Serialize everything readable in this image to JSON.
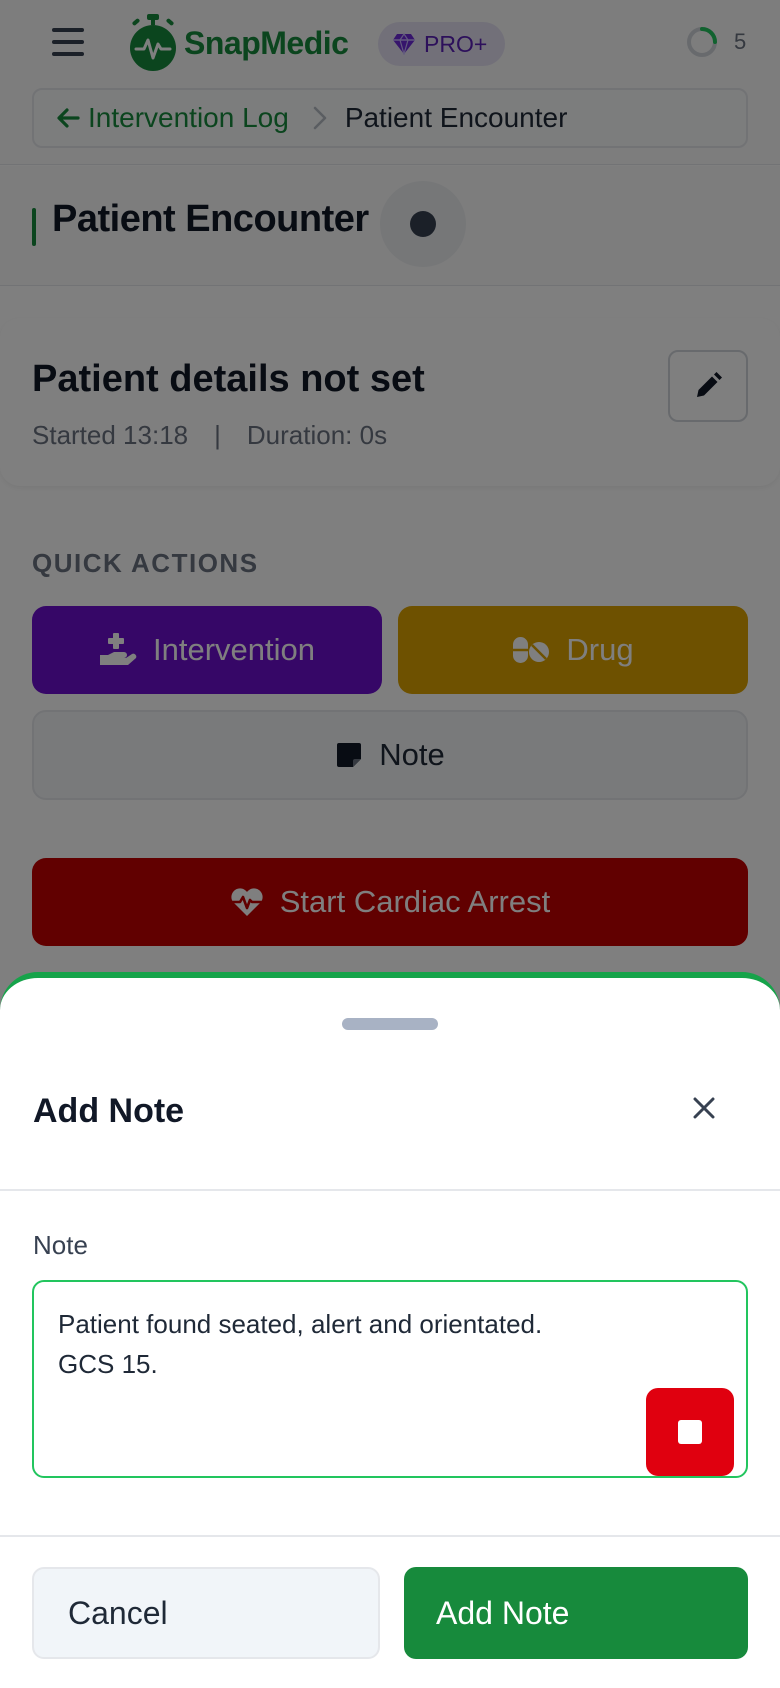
{
  "header": {
    "app_name": "SnapMedic",
    "plan_badge": "PRO+",
    "sync_count": "5",
    "brand_color": "#178a3c"
  },
  "breadcrumb": {
    "back_label": "Intervention Log",
    "current": "Patient Encounter"
  },
  "page": {
    "title": "Patient Encounter"
  },
  "patient": {
    "title": "Patient details not set",
    "started": "Started 13:18",
    "separator": "|",
    "duration": "Duration: 0s"
  },
  "quick_actions": {
    "heading": "QUICK ACTIONS",
    "intervention_label": "Intervention",
    "drug_label": "Drug",
    "note_label": "Note",
    "cardiac_label": "Start Cardiac Arrest"
  },
  "sheet": {
    "title": "Add Note",
    "field_label": "Note",
    "note_value": "Patient found seated, alert and orientated.\nGCS 15.",
    "cancel_label": "Cancel",
    "submit_label": "Add Note"
  },
  "icons": [
    "menu-icon",
    "stopwatch-heart-icon",
    "gem-icon",
    "sync-spinner-icon",
    "arrow-left-icon",
    "chevron-right-icon",
    "pencil-icon",
    "hand-medical-icon",
    "pills-icon",
    "sticky-note-icon",
    "heart-pulse-icon",
    "close-icon",
    "stop-icon"
  ]
}
